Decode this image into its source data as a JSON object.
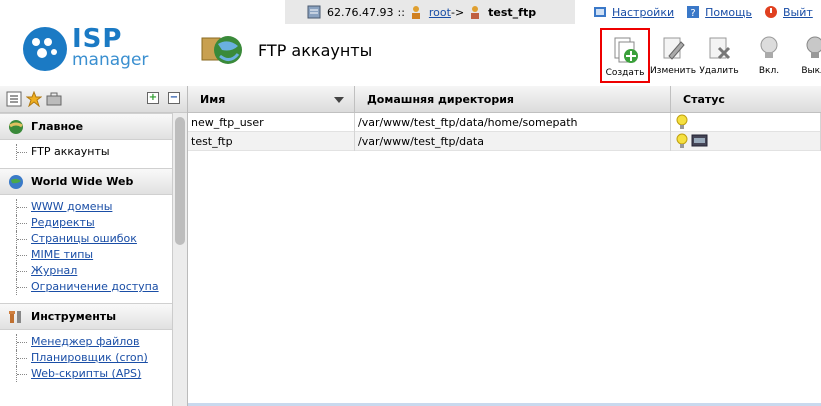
{
  "session": {
    "ip": "62.76.47.93",
    "sep": "::",
    "user": "root",
    "arrow": "->",
    "target": "test_ftp"
  },
  "toplinks": [
    {
      "label": "Настройки"
    },
    {
      "label": "Помощь"
    },
    {
      "label": "Выйт"
    }
  ],
  "logo": {
    "isp": "ISP",
    "manager": "manager"
  },
  "page": {
    "title": "FTP аккаунты"
  },
  "toolbar": {
    "create": "Создать",
    "edit": "Изменить",
    "delete": "Удалить",
    "on": "Вкл.",
    "off": "Выкл."
  },
  "sidebar": {
    "sections": [
      {
        "title": "Главное",
        "items": [
          "FTP аккаунты"
        ]
      },
      {
        "title": "World Wide Web",
        "items": [
          "WWW домены",
          "Редиректы",
          "Страницы ошибок",
          "MIME типы",
          "Журнал",
          "Ограничение доступа"
        ]
      },
      {
        "title": "Инструменты",
        "items": [
          "Менеджер файлов",
          "Планировщик (cron)",
          "Web-скрипты (APS)"
        ]
      }
    ]
  },
  "table": {
    "columns": [
      "Имя",
      "Домашняя директория",
      "Статус"
    ],
    "rows": [
      {
        "name": "new_ftp_user",
        "home": "/var/www/test_ftp/data/home/somepath"
      },
      {
        "name": "test_ftp",
        "home": "/var/www/test_ftp/data"
      }
    ]
  },
  "colors": {
    "accent": "#1b7ac4",
    "link": "#1a4ea6",
    "highlight": "#ee0000"
  }
}
